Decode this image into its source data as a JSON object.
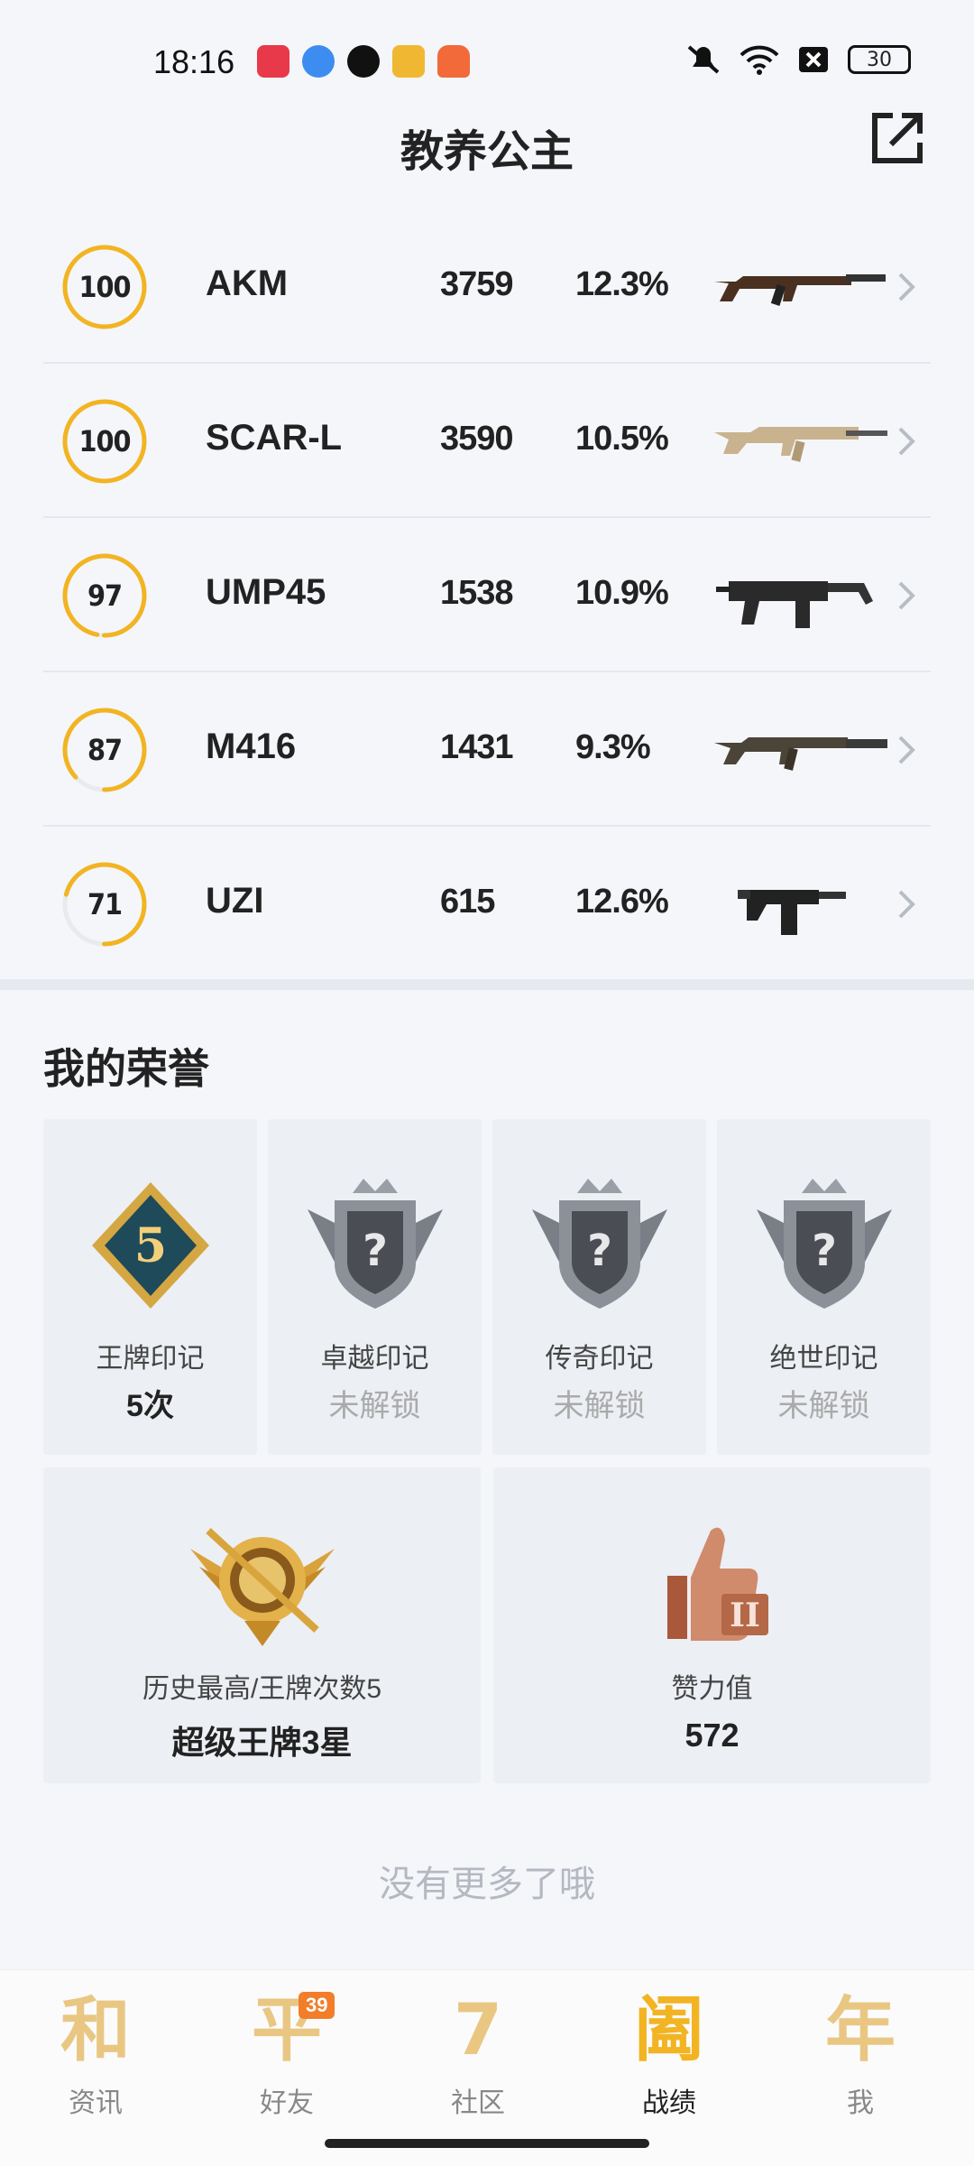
{
  "status_bar": {
    "time": "18:16",
    "battery": "30"
  },
  "header": {
    "title": "教养公主"
  },
  "weapons": [
    {
      "name": "AKM",
      "score": "100",
      "score_value": 100,
      "count": "3759",
      "rate": "12.3%"
    },
    {
      "name": "SCAR-L",
      "score": "100",
      "score_value": 100,
      "count": "3590",
      "rate": "10.5%"
    },
    {
      "name": "UMP45",
      "score": "97",
      "score_value": 97,
      "count": "1538",
      "rate": "10.9%"
    },
    {
      "name": "M416",
      "score": "87",
      "score_value": 87,
      "count": "1431",
      "rate": "9.3%"
    },
    {
      "name": "UZI",
      "score": "71",
      "score_value": 71,
      "count": "615",
      "rate": "12.6%"
    }
  ],
  "honors": {
    "title": "我的荣誉",
    "marks": [
      {
        "label": "王牌印记",
        "value": "5次",
        "badge_text": "5",
        "locked": false
      },
      {
        "label": "卓越印记",
        "value": "未解锁",
        "badge_text": "?",
        "locked": true
      },
      {
        "label": "传奇印记",
        "value": "未解锁",
        "badge_text": "?",
        "locked": true
      },
      {
        "label": "绝世印记",
        "value": "未解锁",
        "badge_text": "?",
        "locked": true
      }
    ],
    "rank": {
      "label": "历史最高/王牌次数5",
      "value": "超级王牌3星"
    },
    "likes": {
      "label": "赞力值",
      "value": "572"
    }
  },
  "footer_text": "没有更多了哦",
  "nav": {
    "items": [
      {
        "glyph": "和",
        "label": "资讯",
        "active": false
      },
      {
        "glyph": "平",
        "label": "好友",
        "active": false,
        "badge": "39"
      },
      {
        "glyph": "7",
        "label": "社区",
        "active": false
      },
      {
        "glyph": "阖",
        "label": "战绩",
        "active": true
      },
      {
        "glyph": "年",
        "label": "我",
        "active": false
      }
    ]
  },
  "colors": {
    "ring": "#f2b422",
    "ring_track": "#e8eaee",
    "accent": "#f2b422"
  }
}
